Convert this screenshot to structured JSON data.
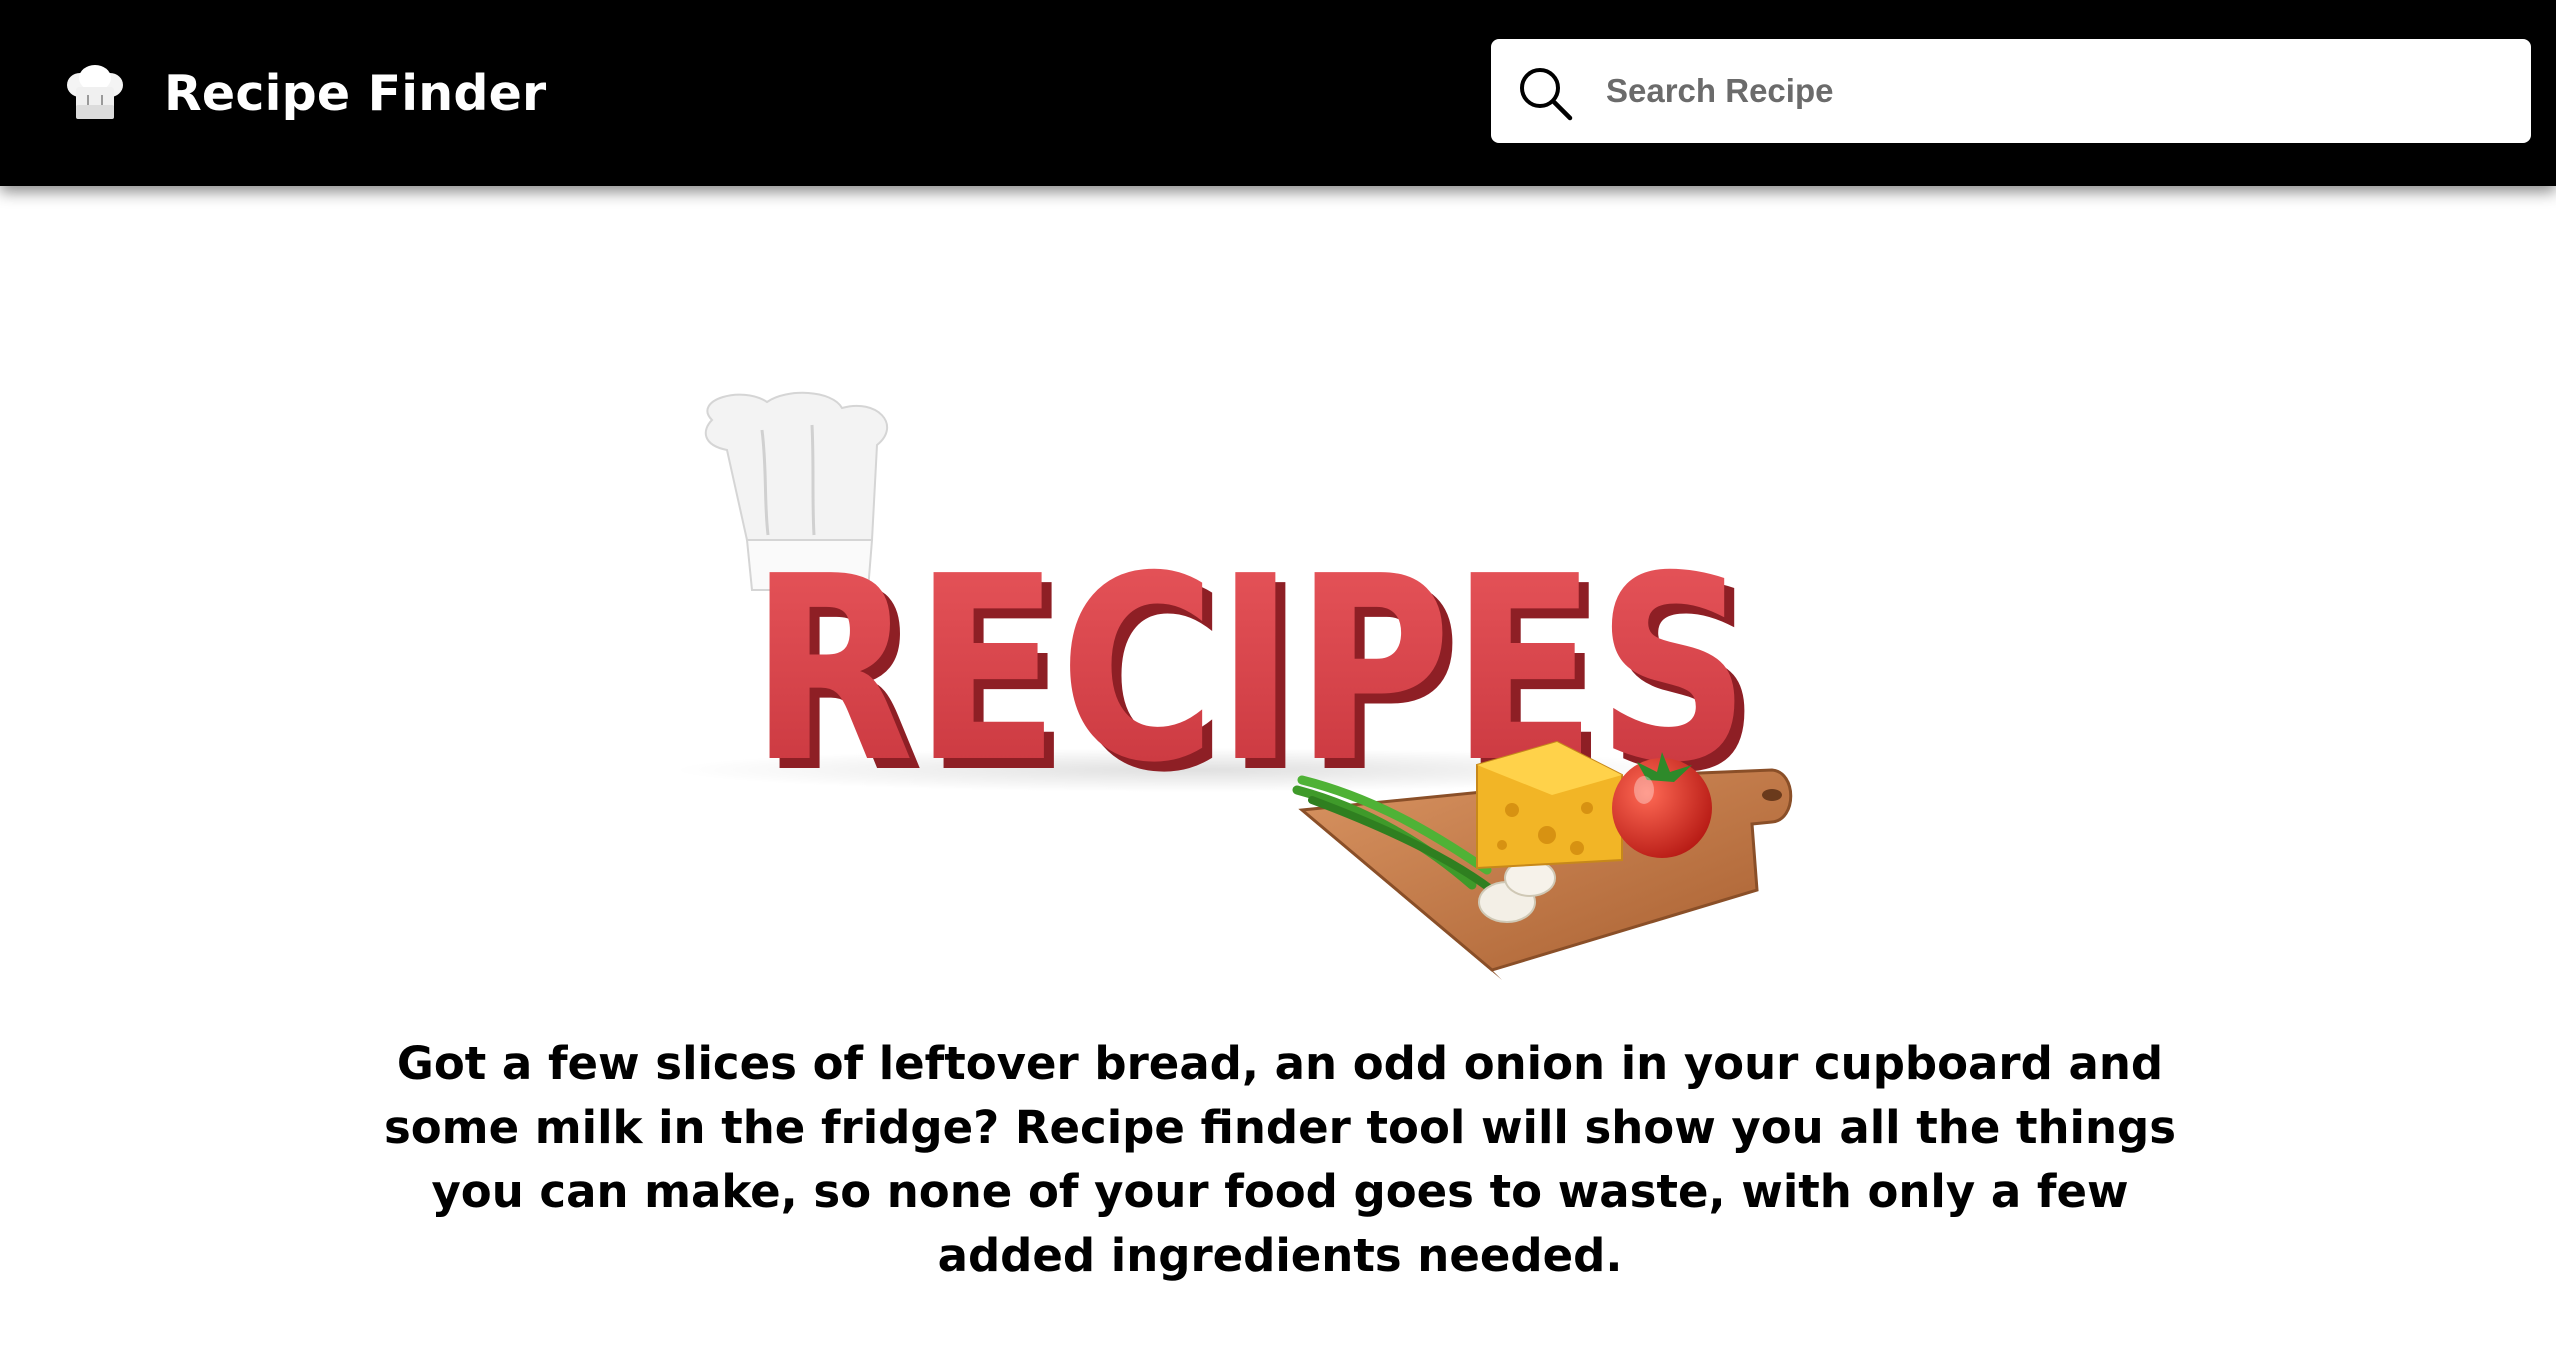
{
  "header": {
    "brand_title": "Recipe Finder",
    "brand_icon": "chef-hat-icon"
  },
  "search": {
    "placeholder": "Search Recipe",
    "value": "",
    "icon": "search-icon"
  },
  "hero": {
    "image_text": "RECIPES"
  },
  "tagline": "Got a few slices of leftover bread, an odd onion in your cupboard and some milk in the fridge? Recipe finder tool will show you all the things you can make, so none of your food goes to waste, with only a few added ingredients needed.",
  "colors": {
    "navbar_bg": "#000000",
    "hero_letters": "#d8434a",
    "board": "#c47a45",
    "cheese": "#f2b526",
    "tomato": "#d82a22"
  }
}
